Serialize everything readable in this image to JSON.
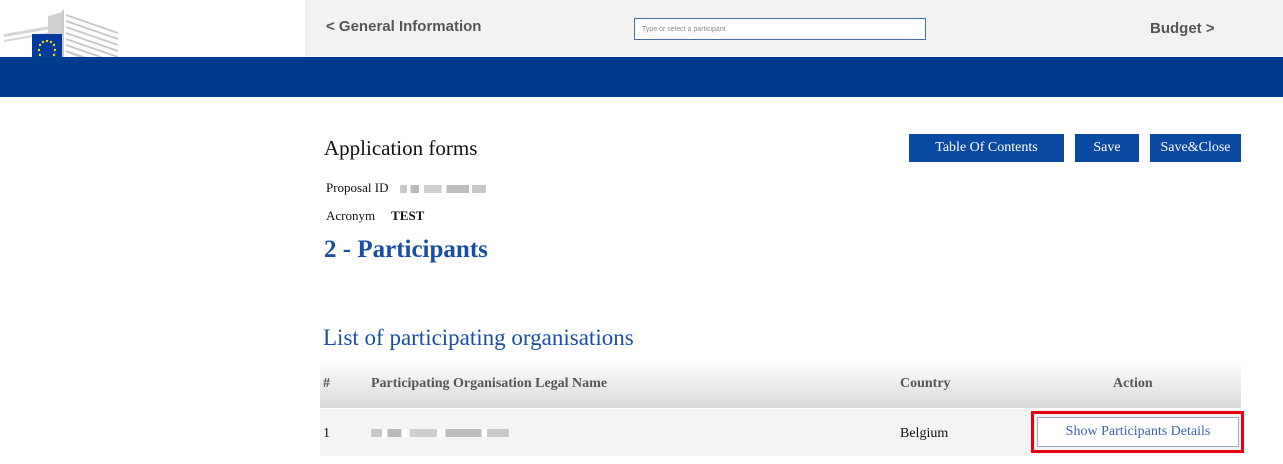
{
  "header": {
    "prev_link": "< General Information",
    "next_link": "Budget >",
    "participant_search": {
      "placeholder": "Type or select a participant",
      "value": ""
    }
  },
  "form": {
    "title": "Application forms",
    "proposal_id_label": "Proposal ID",
    "acronym_label": "Acronym",
    "acronym_value": "TEST",
    "section_title": "2 - Participants",
    "list_title": "List of participating organisations"
  },
  "toolbar": {
    "toc_label": "Table Of Contents",
    "save_label": "Save",
    "save_close_label": "Save&Close"
  },
  "table": {
    "columns": [
      "#",
      "Participating Organisation Legal Name",
      "Country",
      "Action"
    ],
    "rows": [
      {
        "num": "1",
        "country": "Belgium",
        "action_label": "Show Participants Details"
      }
    ]
  },
  "colors": {
    "brand_blue": "#003a8c",
    "button_blue": "#0b4aa3",
    "heading_blue": "#1a4ea6",
    "highlight_red": "#e8000f"
  }
}
